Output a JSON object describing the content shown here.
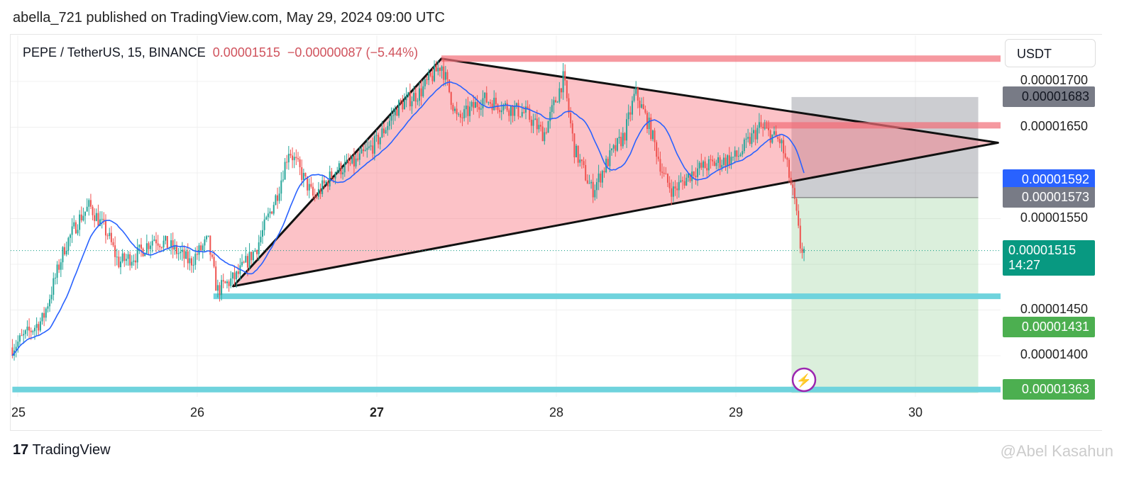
{
  "header": {
    "published": "abella_721 published on TradingView.com, May 29, 2024 09:00 UTC"
  },
  "legend": {
    "symbol": "PEPE / TetherUS, 15, BINANCE",
    "price": "0.00001515",
    "change": "−0.00000087 (−5.44%)"
  },
  "currency": "USDT",
  "footer": {
    "logo": "TradingView",
    "watermark": "@Abel Kasahun"
  },
  "colors": {
    "up": "#26a69a",
    "down": "#ef5350",
    "ma": "#2962ff",
    "triangle": "#f8a5ab",
    "cyan": "#6fd3dd"
  },
  "chart_data": {
    "type": "candlestick",
    "title": "PEPE / TetherUS, 15, BINANCE",
    "price_unit": "1e-8 USDT",
    "x_ticks": [
      {
        "day": 25,
        "label": "25"
      },
      {
        "day": 26,
        "label": "26"
      },
      {
        "day": 27,
        "label": "27"
      },
      {
        "day": 28,
        "label": "28"
      },
      {
        "day": 29,
        "label": "29"
      },
      {
        "day": 30,
        "label": "30"
      }
    ],
    "y_ticks": [
      "0.00001700",
      "0.00001650",
      "0.00001550",
      "0.00001450",
      "0.00001400"
    ],
    "y_tick_values": [
      1700,
      1650,
      1550,
      1450,
      1400
    ],
    "ylim": [
      1300,
      1750
    ],
    "xlim": [
      24.97,
      30.5
    ],
    "close_path": [
      [
        24.97,
        1409
      ],
      [
        25.14,
        1440
      ],
      [
        25.26,
        1518
      ],
      [
        25.34,
        1549
      ],
      [
        25.4,
        1564
      ],
      [
        25.5,
        1533
      ],
      [
        25.56,
        1502
      ],
      [
        25.66,
        1510
      ],
      [
        25.76,
        1529
      ],
      [
        25.86,
        1518
      ],
      [
        25.96,
        1502
      ],
      [
        26.06,
        1526
      ],
      [
        26.11,
        1471
      ],
      [
        26.22,
        1487
      ],
      [
        26.33,
        1518
      ],
      [
        26.45,
        1580
      ],
      [
        26.51,
        1626
      ],
      [
        26.57,
        1603
      ],
      [
        26.65,
        1572
      ],
      [
        26.77,
        1603
      ],
      [
        26.88,
        1611
      ],
      [
        27.0,
        1634
      ],
      [
        27.12,
        1673
      ],
      [
        27.24,
        1688
      ],
      [
        27.36,
        1719
      ],
      [
        27.45,
        1657
      ],
      [
        27.59,
        1681
      ],
      [
        27.71,
        1673
      ],
      [
        27.83,
        1665
      ],
      [
        27.93,
        1642
      ],
      [
        28.04,
        1704
      ],
      [
        28.1,
        1626
      ],
      [
        28.2,
        1580
      ],
      [
        28.3,
        1618
      ],
      [
        28.38,
        1642
      ],
      [
        28.44,
        1688
      ],
      [
        28.52,
        1650
      ],
      [
        28.6,
        1595
      ],
      [
        28.65,
        1580
      ],
      [
        28.77,
        1603
      ],
      [
        28.89,
        1611
      ],
      [
        29.01,
        1618
      ],
      [
        29.13,
        1650
      ],
      [
        29.25,
        1634
      ],
      [
        29.29,
        1603
      ],
      [
        29.33,
        1564
      ],
      [
        29.36,
        1518
      ],
      [
        29.38,
        1515
      ]
    ],
    "drawings": {
      "triangle": [
        [
          27.36,
          1725
        ],
        [
          26.2,
          1476
        ],
        [
          30.46,
          1633
        ]
      ],
      "resistance_lines": [
        {
          "from": 27.36,
          "price": 1725
        },
        {
          "from": 29.15,
          "price": 1652
        }
      ],
      "support_lines": [
        {
          "from": 26.09,
          "price": 1465
        },
        {
          "from": 24.97,
          "price": 1363
        }
      ],
      "position": {
        "from": 29.31,
        "to": 30.35,
        "stop": 1683,
        "entry": 1573,
        "target": 1363
      }
    },
    "price_labels": [
      {
        "text": "0.00001683",
        "bg": "#787b86",
        "fg": "#131722"
      },
      {
        "text": "0.00001592",
        "bg": "#2962ff",
        "fg": "#ffffff"
      },
      {
        "text": "0.00001573",
        "bg": "#787b86",
        "fg": "#ffffff"
      },
      {
        "text": "0.00001515",
        "sub": "14:27",
        "bg": "#089981",
        "fg": "#ffffff"
      },
      {
        "text": "0.00001431",
        "bg": "#4caf50",
        "fg": "#ffffff"
      },
      {
        "text": "0.00001363",
        "bg": "#4caf50",
        "fg": "#ffffff"
      }
    ],
    "price_label_values": [
      1683,
      1592,
      1573,
      1515,
      1431,
      1363
    ]
  }
}
